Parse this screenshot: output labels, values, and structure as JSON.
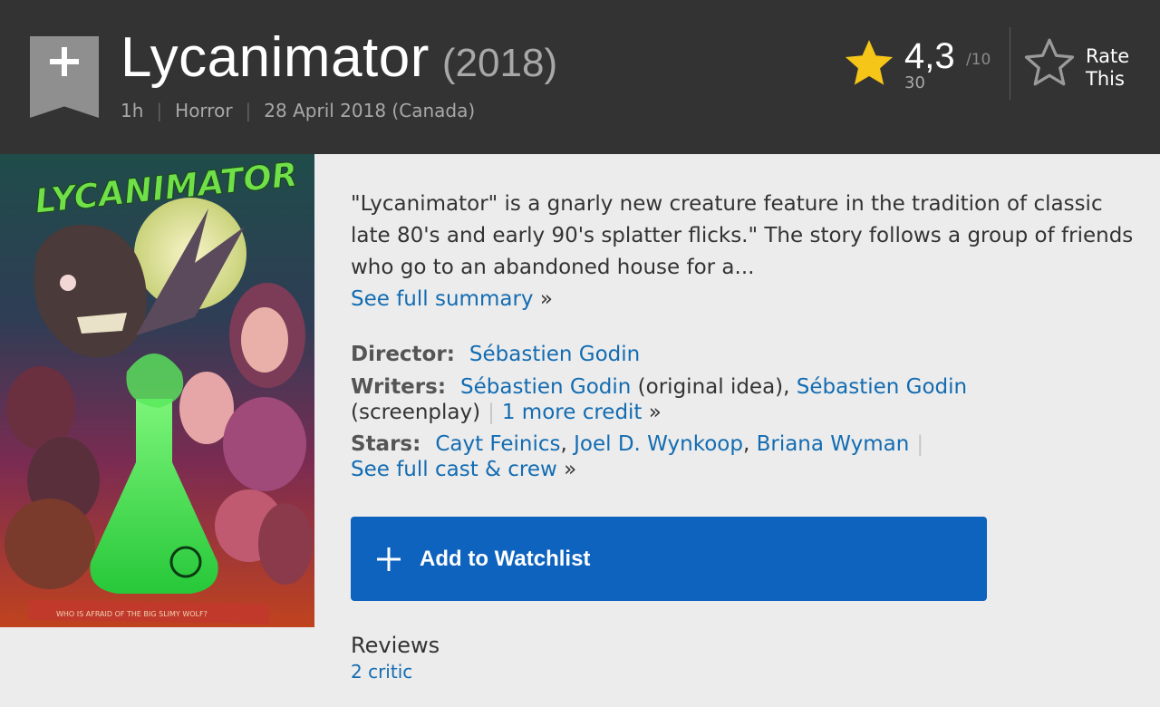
{
  "header": {
    "title": "Lycanimator",
    "year": "(2018)",
    "runtime": "1h",
    "genre": "Horror",
    "release": "28 April 2018 (Canada)",
    "rating": "4,3",
    "rating_scale": "/10",
    "rating_count": "30",
    "rate_label_1": "Rate",
    "rate_label_2": "This"
  },
  "poster": {
    "title_art": "LYCANIMATOR",
    "tagline": "WHO IS AFRAID OF THE BIG SLIMY WOLF?"
  },
  "summary": {
    "text": "\"Lycanimator\" is a gnarly new creature feature in the tradition of classic late 80's and early 90's splatter flicks.\" The story follows a group of friends who go to an abandoned house for a...",
    "link": "See full summary",
    "arrow": "»"
  },
  "credits": {
    "director_label": "Director:",
    "director": "Sébastien Godin",
    "writers_label": "Writers:",
    "writer1": "Sébastien Godin",
    "writer1_note": " (original idea), ",
    "writer2": "Sébastien Godin",
    "writer2_note": "(screenplay)",
    "more_credit": "1 more credit",
    "stars_label": "Stars:",
    "star1": "Cayt Feinics",
    "star2": "Joel D. Wynkoop",
    "star3": "Briana Wyman",
    "cast_link": "See full cast & crew",
    "arrow": "»"
  },
  "watchlist": {
    "label": "Add to Watchlist"
  },
  "reviews": {
    "heading": "Reviews",
    "critic_link": "2 critic"
  },
  "colors": {
    "header_bg": "#333333",
    "link": "#136cb2",
    "star_gold": "#f5c518",
    "button_blue": "#0e63be",
    "page_bg": "#ececec"
  }
}
